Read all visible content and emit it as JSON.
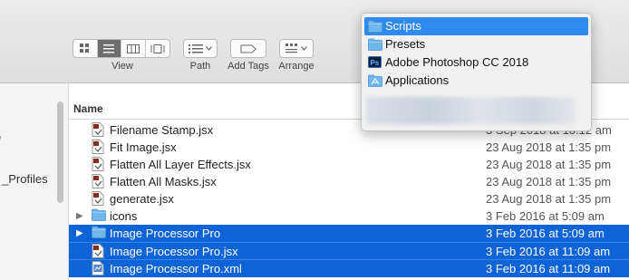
{
  "toolbar": {
    "view_label": "View",
    "path_label": "Path",
    "add_tags_label": "Add Tags",
    "arrange_label": "Arrange"
  },
  "sidebar": {
    "partial_items": [
      "_Profiles"
    ]
  },
  "list": {
    "column_name": "Name",
    "rows": [
      {
        "name": "Filename Stamp.jsx",
        "date": "3 Sep 2018 at 10:12 am",
        "icon": "jsx-script-icon",
        "selected": false,
        "folder": false
      },
      {
        "name": "Fit Image.jsx",
        "date": "23 Aug 2018 at 1:35 pm",
        "icon": "jsx-script-icon",
        "selected": false,
        "folder": false
      },
      {
        "name": "Flatten All Layer Effects.jsx",
        "date": "23 Aug 2018 at 1:35 pm",
        "icon": "jsx-script-icon",
        "selected": false,
        "folder": false
      },
      {
        "name": "Flatten All Masks.jsx",
        "date": "23 Aug 2018 at 1:35 pm",
        "icon": "jsx-script-icon",
        "selected": false,
        "folder": false
      },
      {
        "name": "generate.jsx",
        "date": "23 Aug 2018 at 1:35 pm",
        "icon": "jsx-script-icon",
        "selected": false,
        "folder": false
      },
      {
        "name": "icons",
        "date": "3 Feb 2016 at 5:09 am",
        "icon": "folder-icon",
        "selected": false,
        "folder": true
      },
      {
        "name": "Image Processor Pro",
        "date": "3 Feb 2016 at 5:09 am",
        "icon": "folder-icon",
        "selected": true,
        "folder": true
      },
      {
        "name": "Image Processor Pro.jsx",
        "date": "3 Feb 2016 at 11:09 am",
        "icon": "jsx-script-icon",
        "selected": true,
        "folder": false
      },
      {
        "name": "Image Processor Pro.xml",
        "date": "3 Feb 2016 at 11:09 am",
        "icon": "xml-file-icon",
        "selected": true,
        "folder": false
      }
    ]
  },
  "path_menu": {
    "items": [
      {
        "label": "Scripts",
        "icon": "folder-icon",
        "selected": true
      },
      {
        "label": "Presets",
        "icon": "folder-icon",
        "selected": false
      },
      {
        "label": "Adobe Photoshop CC 2018",
        "icon": "photoshop-icon",
        "selected": false
      },
      {
        "label": "Applications",
        "icon": "applications-folder-icon",
        "selected": false
      }
    ]
  },
  "colors": {
    "selection": "#0e63d6",
    "menu_highlight": "#2f8aef",
    "folder": "#6fb6ec"
  }
}
